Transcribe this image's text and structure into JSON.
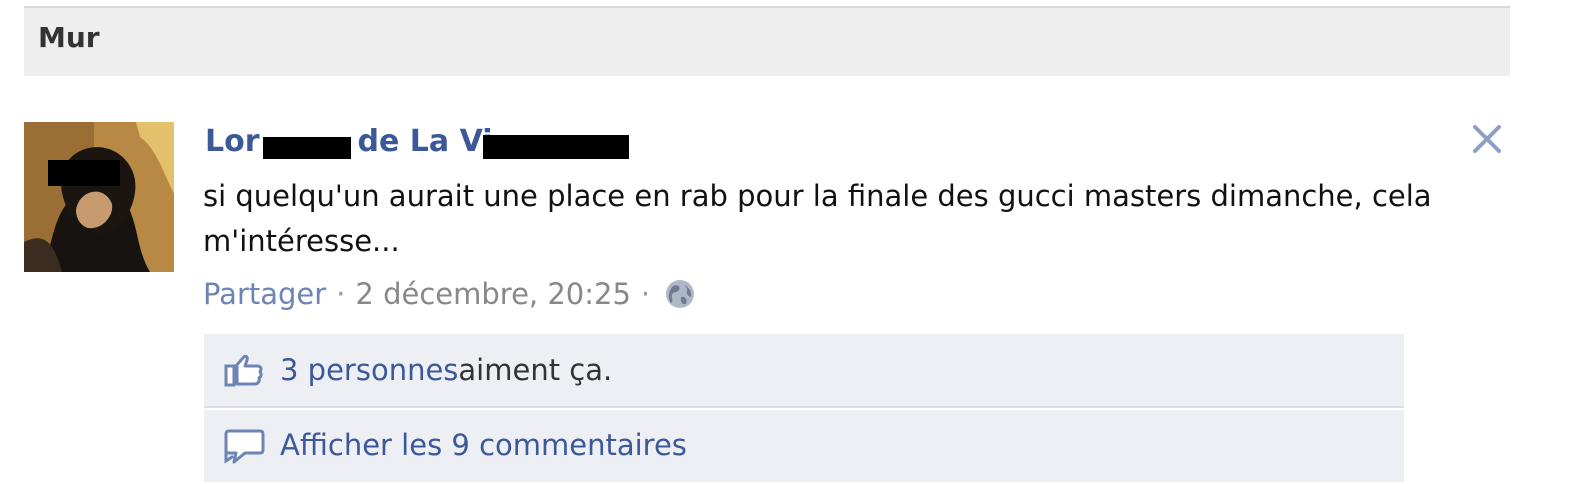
{
  "wall": {
    "title": "Mur"
  },
  "post": {
    "author": {
      "name_visible_part_1": "Lor",
      "name_visible_part_2": "de La Vi"
    },
    "text": "si quelqu'un aurait une place en rab pour la finale des gucci masters dimanche, cela m'intéresse...",
    "meta": {
      "share_label": "Partager",
      "separator": "·",
      "timestamp": "2 décembre, 20:25",
      "privacy_icon": "globe-icon"
    },
    "close_icon": "close-icon"
  },
  "feedback": {
    "likes": {
      "icon": "thumbs-up-icon",
      "link_text": "3 personnes",
      "rest_text": " aiment ça."
    },
    "comments": {
      "icon": "comment-icon",
      "link_text": "Afficher les 9 commentaires"
    }
  },
  "colors": {
    "brand_blue": "#3b5998",
    "light_link_blue": "#6d84b4",
    "feedback_background": "#edeff4",
    "header_background": "#eeeeee"
  }
}
